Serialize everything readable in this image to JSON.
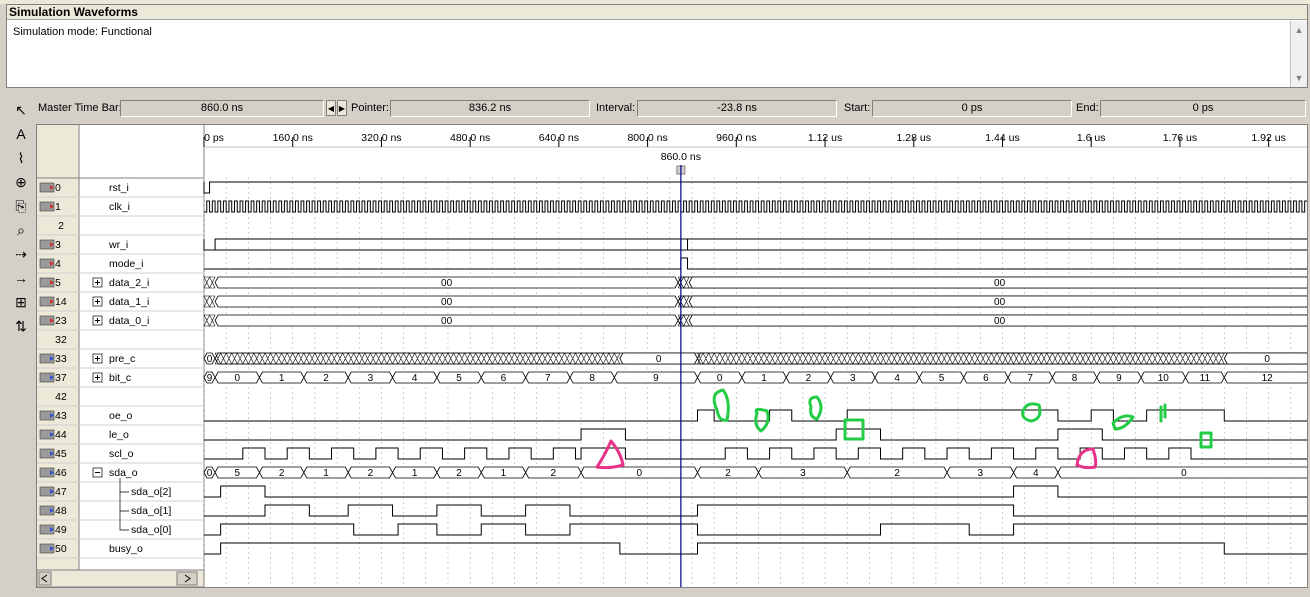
{
  "panel": {
    "title": "Simulation Waveforms",
    "mode_text": "Simulation mode: Functional"
  },
  "timebar": {
    "master_label": "Master Time Bar:",
    "master_value": "860.0 ns",
    "pointer_label": "Pointer:",
    "pointer_value": "836.2 ns",
    "interval_label": "Interval:",
    "interval_value": "-23.8 ns",
    "start_label": "Start:",
    "start_value": "0 ps",
    "end_label": "End:",
    "end_value": "0 ps"
  },
  "ruler": {
    "ticks": [
      "0 ps",
      "160.0 ns",
      "320.0 ns",
      "480.0 ns",
      "640.0 ns",
      "800.0 ns",
      "960.0 ns",
      "1.12 us",
      "1.28 us",
      "1.44 us",
      "1.6 us",
      "1.76 us",
      "1.92 us"
    ],
    "cursor_label": "860.0 ns"
  },
  "tools": [
    {
      "name": "pointer-tool-icon",
      "glyph": "↖"
    },
    {
      "name": "text-tool-icon",
      "glyph": "A"
    },
    {
      "name": "waveform-edit-icon",
      "glyph": "⌇"
    },
    {
      "name": "zoom-icon",
      "glyph": "⊕"
    },
    {
      "name": "copy-icon",
      "glyph": "⎘"
    },
    {
      "name": "find-icon",
      "glyph": "⌕"
    },
    {
      "name": "replace-icon",
      "glyph": "⇢"
    },
    {
      "name": "assign-value-icon",
      "glyph": "→"
    },
    {
      "name": "group-icon",
      "glyph": "⊞"
    },
    {
      "name": "sort-icon",
      "glyph": "⇅"
    }
  ],
  "colors": {
    "cursor": "#00008b",
    "green_marks": "#22cc44",
    "pink_marks": "#e8338a"
  },
  "signals": [
    {
      "id": "0",
      "name": "rst_i",
      "kind": "in",
      "expand": ""
    },
    {
      "id": "1",
      "name": "clk_i",
      "kind": "in",
      "expand": ""
    },
    {
      "id": "2",
      "name": "",
      "kind": "none",
      "expand": ""
    },
    {
      "id": "3",
      "name": "wr_i",
      "kind": "in",
      "expand": ""
    },
    {
      "id": "4",
      "name": "mode_i",
      "kind": "in",
      "expand": ""
    },
    {
      "id": "5",
      "name": "data_2_i",
      "kind": "in",
      "expand": "+"
    },
    {
      "id": "14",
      "name": "data_1_i",
      "kind": "in",
      "expand": "+"
    },
    {
      "id": "23",
      "name": "data_0_i",
      "kind": "in",
      "expand": "+"
    },
    {
      "id": "32",
      "name": "",
      "kind": "none",
      "expand": ""
    },
    {
      "id": "33",
      "name": "pre_c",
      "kind": "bury",
      "expand": "+"
    },
    {
      "id": "37",
      "name": "bit_c",
      "kind": "bury",
      "expand": "+"
    },
    {
      "id": "42",
      "name": "",
      "kind": "none",
      "expand": ""
    },
    {
      "id": "43",
      "name": "oe_o",
      "kind": "out",
      "expand": ""
    },
    {
      "id": "44",
      "name": "le_o",
      "kind": "out",
      "expand": ""
    },
    {
      "id": "45",
      "name": "scl_o",
      "kind": "out",
      "expand": ""
    },
    {
      "id": "46",
      "name": "sda_o",
      "kind": "out",
      "expand": "−"
    },
    {
      "id": "47",
      "name": "sda_o[2]",
      "kind": "out",
      "expand": ""
    },
    {
      "id": "48",
      "name": "sda_o[1]",
      "kind": "out",
      "expand": ""
    },
    {
      "id": "49",
      "name": "sda_o[0]",
      "kind": "out",
      "expand": ""
    },
    {
      "id": "50",
      "name": "busy_o",
      "kind": "out",
      "expand": ""
    }
  ],
  "bus_values": {
    "data_2_i": [
      "00",
      "00"
    ],
    "data_1_i": [
      "00",
      "00"
    ],
    "data_0_i": [
      "00",
      "00"
    ],
    "pre_c": [
      "0",
      "0",
      "0"
    ],
    "bit_c": [
      "9",
      "0",
      "1",
      "2",
      "3",
      "4",
      "5",
      "6",
      "7",
      "8",
      "9",
      "0",
      "1",
      "2",
      "3",
      "4",
      "5",
      "6",
      "7",
      "8",
      "9",
      "10",
      "11",
      "12"
    ],
    "sda_o": [
      "0",
      "5",
      "2",
      "1",
      "2",
      "1",
      "2",
      "1",
      "2",
      "0",
      "2",
      "3",
      "2",
      "3",
      "4",
      "0"
    ]
  }
}
